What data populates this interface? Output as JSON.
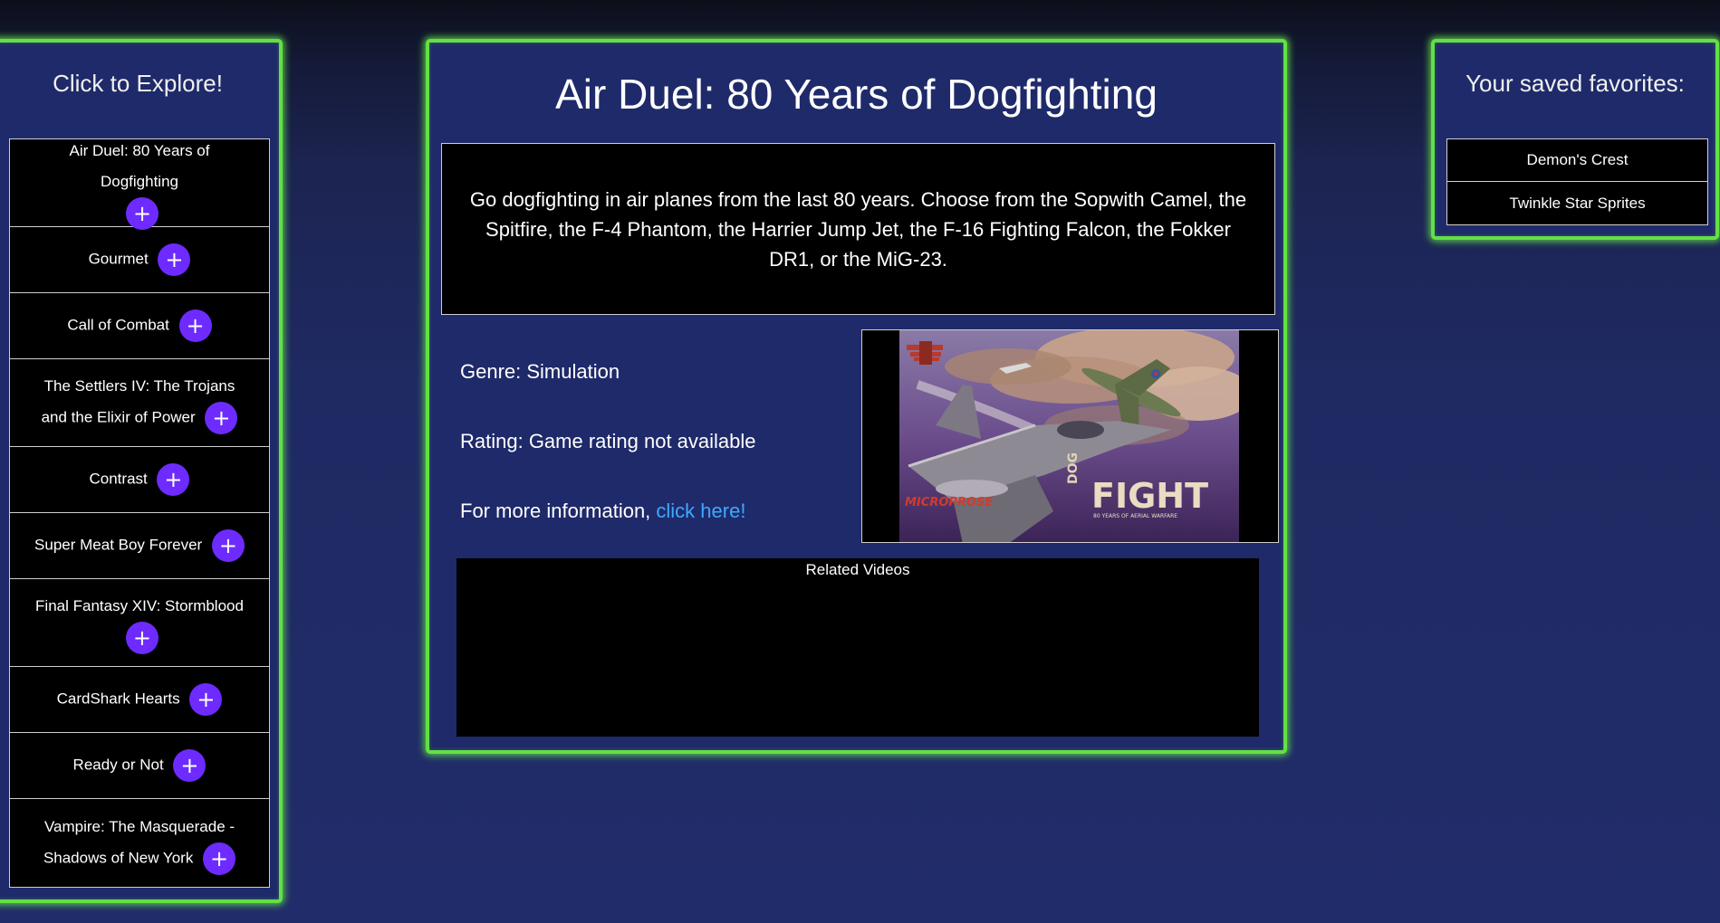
{
  "explore": {
    "heading": "Click to Explore!",
    "add_icon": "+",
    "items": [
      {
        "label": "Air Duel: 80 Years of Dogfighting"
      },
      {
        "label": "Gourmet"
      },
      {
        "label": "Call of Combat"
      },
      {
        "label": "The Settlers IV: The Trojans and the Elixir of Power"
      },
      {
        "label": "Contrast"
      },
      {
        "label": "Super Meat Boy Forever"
      },
      {
        "label": "Final Fantasy XIV: Stormblood"
      },
      {
        "label": "CardShark Hearts"
      },
      {
        "label": "Ready or Not"
      },
      {
        "label": "Vampire: The Masquerade - Shadows of New York"
      }
    ]
  },
  "detail": {
    "title": "Air Duel: 80 Years of Dogfighting",
    "description": "Go dogfighting in air planes from the last 80 years. Choose from the Sopwith Camel, the Spitfire, the F-4 Phantom, the Harrier Jump Jet, the F-16 Fighting Falcon, the Fokker DR1, or the MiG-23.",
    "genre": "Genre: Simulation",
    "rating": "Rating: Game rating not available",
    "more_info_prefix": "For more information, ",
    "more_info_link": "click here!",
    "related_videos_label": "Related Videos",
    "cover": {
      "publisher": "MICROPROSE",
      "title_vertical": "DOG",
      "title_main": "FIGHT",
      "tagline": "80 YEARS OF AERIAL WARFARE"
    }
  },
  "favorites": {
    "heading": "Your saved favorites:",
    "items": [
      {
        "label": "Demon's Crest"
      },
      {
        "label": "Twinkle Star Sprites"
      }
    ]
  },
  "colors": {
    "accent_green": "#63e045",
    "button_purple": "#6e2bff",
    "link_blue": "#3da9ff",
    "panel_bg": "#1f2a6a"
  }
}
